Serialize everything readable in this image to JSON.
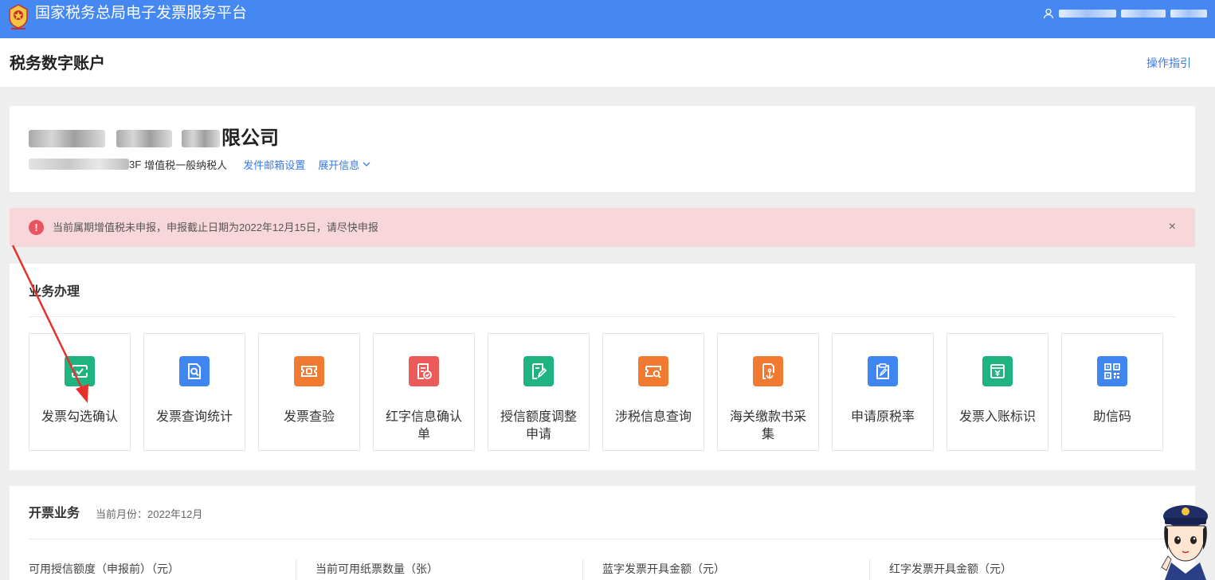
{
  "topbar": {
    "platform_title": "国家税务总局电子发票服务平台"
  },
  "subheader": {
    "page_title": "税务数字账户",
    "guide_link": "操作指引"
  },
  "company": {
    "name_suffix": "限公司",
    "taxpayer_id_suffix": "3F",
    "taxpayer_type": "增值税一般纳税人",
    "email_settings_link": "发件邮箱设置",
    "expand_info_link": "展开信息"
  },
  "alert": {
    "message": "当前属期增值税未申报，申报截止日期为2022年12月15日，请尽快申报",
    "close": "×"
  },
  "business": {
    "title": "业务办理",
    "tiles": [
      {
        "label": "发票勾选确认",
        "icon": "invoice-check-icon",
        "color": "#1fb37f"
      },
      {
        "label": "发票查询统计",
        "icon": "document-search-icon",
        "color": "#3f86f0"
      },
      {
        "label": "发票查验",
        "icon": "ticket-verify-icon",
        "color": "#f07a32"
      },
      {
        "label": "红字信息确认单",
        "icon": "document-check-icon",
        "color": "#ec5a5a"
      },
      {
        "label": "授信额度调整申请",
        "icon": "edit-document-icon",
        "color": "#1fb37f"
      },
      {
        "label": "涉税信息查询",
        "icon": "ticket-search-icon",
        "color": "#f07a32"
      },
      {
        "label": "海关缴款书采集",
        "icon": "anchor-document-icon",
        "color": "#f07a32"
      },
      {
        "label": "申请原税率",
        "icon": "clipboard-edit-icon",
        "color": "#3f86f0"
      },
      {
        "label": "发票入账标识",
        "icon": "invoice-tag-icon",
        "color": "#1fb37f"
      },
      {
        "label": "助信码",
        "icon": "qr-code-icon",
        "color": "#3f86f0"
      }
    ]
  },
  "invoicing": {
    "title": "开票业务",
    "current_month": "当前月份：2022年12月",
    "stats": [
      "可用授信额度（申报前）（元）",
      "当前可用纸票数量（张）",
      "蓝字发票开具金额（元）",
      "红字发票开具金额（元）"
    ]
  },
  "colors": {
    "topbar": "#4688f1",
    "link": "#3a7be8",
    "alert_bg": "#f8d7db",
    "alert_icon": "#e9545f",
    "annotation_arrow": "#e8302a"
  }
}
